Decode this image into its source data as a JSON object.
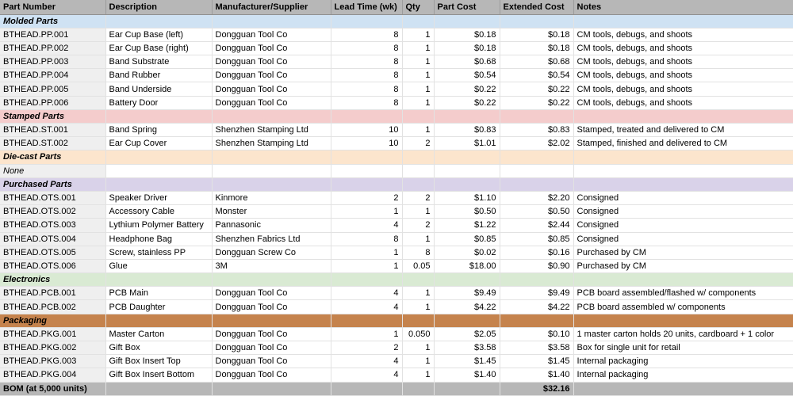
{
  "table": {
    "columns": [
      {
        "label": "Part Number"
      },
      {
        "label": "Description"
      },
      {
        "label": "Manufacturer/Supplier"
      },
      {
        "label": "Lead Time (wk)"
      },
      {
        "label": "Qty"
      },
      {
        "label": "Part Cost"
      },
      {
        "label": "Extended Cost"
      },
      {
        "label": "Notes"
      }
    ],
    "colors": {
      "header_bg": "#b7b7b7",
      "first_col_bg": "#efefef",
      "total_bg": "#b7b7b7",
      "grid": "#e2e2e2",
      "sections": {
        "molded": "#cfe2f3",
        "stamped": "#f4cccc",
        "diecast": "#fce5cd",
        "purchased": "#d9d2e9",
        "electronics": "#d9ead3",
        "packaging": "#c5834d"
      }
    },
    "rows": [
      {
        "type": "section",
        "section": "molded",
        "label": "Molded Parts"
      },
      {
        "type": "item",
        "cells": [
          "BTHEAD.PP.001",
          "Ear Cup Base (left)",
          "Dongguan Tool Co",
          "8",
          "1",
          "$0.18",
          "$0.18",
          "CM tools, debugs, and shoots"
        ]
      },
      {
        "type": "item",
        "cells": [
          "BTHEAD.PP.002",
          "Ear Cup Base (right)",
          "Dongguan Tool Co",
          "8",
          "1",
          "$0.18",
          "$0.18",
          "CM tools, debugs, and shoots"
        ]
      },
      {
        "type": "item",
        "cells": [
          "BTHEAD.PP.003",
          "Band Substrate",
          "Dongguan Tool Co",
          "8",
          "1",
          "$0.68",
          "$0.68",
          "CM tools, debugs, and shoots"
        ]
      },
      {
        "type": "item",
        "cells": [
          "BTHEAD.PP.004",
          "Band Rubber",
          "Dongguan Tool Co",
          "8",
          "1",
          "$0.54",
          "$0.54",
          "CM tools, debugs, and shoots"
        ]
      },
      {
        "type": "item",
        "cells": [
          "BTHEAD.PP.005",
          "Band Underside",
          "Dongguan Tool Co",
          "8",
          "1",
          "$0.22",
          "$0.22",
          "CM tools, debugs, and shoots"
        ]
      },
      {
        "type": "item",
        "cells": [
          "BTHEAD.PP.006",
          "Battery Door",
          "Dongguan Tool Co",
          "8",
          "1",
          "$0.22",
          "$0.22",
          "CM tools, debugs, and shoots"
        ]
      },
      {
        "type": "section",
        "section": "stamped",
        "label": "Stamped Parts"
      },
      {
        "type": "item",
        "cells": [
          "BTHEAD.ST.001",
          "Band Spring",
          "Shenzhen Stamping Ltd",
          "10",
          "1",
          "$0.83",
          "$0.83",
          "Stamped, treated and delivered to CM"
        ]
      },
      {
        "type": "item",
        "cells": [
          "BTHEAD.ST.002",
          "Ear Cup Cover",
          "Shenzhen Stamping Ltd",
          "10",
          "2",
          "$1.01",
          "$2.02",
          "Stamped, finished and delivered to CM"
        ]
      },
      {
        "type": "section",
        "section": "diecast",
        "label": "Die-cast Parts"
      },
      {
        "type": "none",
        "cells": [
          "None",
          "",
          "",
          "",
          "",
          "",
          "",
          ""
        ]
      },
      {
        "type": "section",
        "section": "purchased",
        "label": "Purchased Parts"
      },
      {
        "type": "item",
        "cells": [
          "BTHEAD.OTS.001",
          "Speaker Driver",
          "Kinmore",
          "2",
          "2",
          "$1.10",
          "$2.20",
          "Consigned"
        ]
      },
      {
        "type": "item",
        "cells": [
          "BTHEAD.OTS.002",
          "Accessory Cable",
          "Monster",
          "1",
          "1",
          "$0.50",
          "$0.50",
          "Consigned"
        ]
      },
      {
        "type": "item",
        "cells": [
          "BTHEAD.OTS.003",
          "Lythium Polymer Battery",
          "Pannasonic",
          "4",
          "2",
          "$1.22",
          "$2.44",
          "Consigned"
        ]
      },
      {
        "type": "item",
        "cells": [
          "BTHEAD.OTS.004",
          "Headphone Bag",
          "Shenzhen Fabrics Ltd",
          "8",
          "1",
          "$0.85",
          "$0.85",
          "Consigned"
        ]
      },
      {
        "type": "item",
        "cells": [
          "BTHEAD.OTS.005",
          "Screw, stainless PP",
          "Dongguan Screw Co",
          "1",
          "8",
          "$0.02",
          "$0.16",
          "Purchased by CM"
        ]
      },
      {
        "type": "item",
        "cells": [
          "BTHEAD.OTS.006",
          "Glue",
          "3M",
          "1",
          "0.05",
          "$18.00",
          "$0.90",
          "Purchased by CM"
        ]
      },
      {
        "type": "section",
        "section": "electronics",
        "label": "Electronics"
      },
      {
        "type": "item",
        "cells": [
          "BTHEAD.PCB.001",
          "PCB Main",
          "Dongguan Tool Co",
          "4",
          "1",
          "$9.49",
          "$9.49",
          "PCB board assembled/flashed w/ components"
        ]
      },
      {
        "type": "item",
        "cells": [
          "BTHEAD.PCB.002",
          "PCB Daughter",
          "Dongguan Tool Co",
          "4",
          "1",
          "$4.22",
          "$4.22",
          "PCB board assembled w/ components"
        ]
      },
      {
        "type": "section",
        "section": "packaging",
        "label": "Packaging"
      },
      {
        "type": "item",
        "cells": [
          "BTHEAD.PKG.001",
          "Master Carton",
          "Dongguan Tool Co",
          "1",
          "0.050",
          "$2.05",
          "$0.10",
          "1 master carton holds 20 units, cardboard + 1 color"
        ]
      },
      {
        "type": "item",
        "cells": [
          "BTHEAD.PKG.002",
          "Gift Box",
          "Dongguan Tool Co",
          "2",
          "1",
          "$3.58",
          "$3.58",
          "Box for single unit for retail"
        ]
      },
      {
        "type": "item",
        "cells": [
          "BTHEAD.PKG.003",
          "Gift Box Insert Top",
          "Dongguan Tool Co",
          "4",
          "1",
          "$1.45",
          "$1.45",
          "Internal packaging"
        ]
      },
      {
        "type": "item",
        "cells": [
          "BTHEAD.PKG.004",
          "Gift Box Insert Bottom",
          "Dongguan Tool Co",
          "4",
          "1",
          "$1.40",
          "$1.40",
          "Internal packaging"
        ]
      },
      {
        "type": "total",
        "label": "BOM (at 5,000 units)",
        "extended_cost": "$32.16"
      }
    ]
  }
}
